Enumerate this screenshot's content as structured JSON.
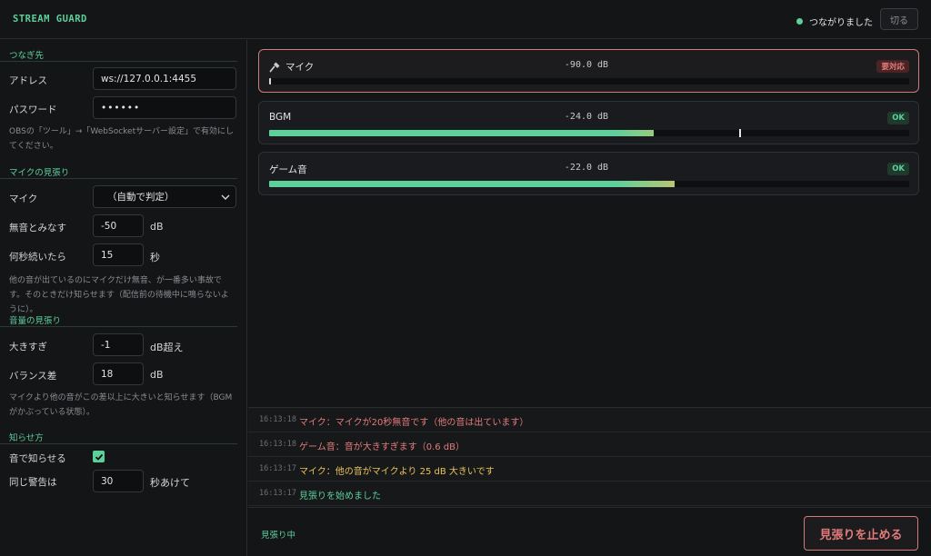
{
  "app": {
    "title": "STREAM GUARD"
  },
  "connection": {
    "status": "つながりました",
    "disconnect_label": "切る",
    "status_color": "#5ccf9b"
  },
  "sidebar": {
    "connect": {
      "title": "つなぎ先",
      "address_label": "アドレス",
      "address_value": "ws://127.0.0.1:4455",
      "password_label": "パスワード",
      "password_value": "••••••",
      "hint": "OBSの「ツール」→「WebSocketサーバー設定」で有効にしてください。"
    },
    "mic_watch": {
      "title": "マイクの見張り",
      "mic_label": "マイク",
      "mic_selected": "（自動で判定）",
      "silence_label": "無音とみなす",
      "silence_value": "-50",
      "silence_unit": "dB",
      "duration_label": "何秒続いたら",
      "duration_value": "15",
      "duration_unit": "秒",
      "hint": "他の音が出ているのにマイクだけ無音、が一番多い事故です。そのときだけ知らせます（配信前の待機中に鳴らないように）。"
    },
    "volume_watch": {
      "title": "音量の見張り",
      "loud_label": "大きすぎ",
      "loud_value": "-1",
      "loud_unit": "dB超え",
      "balance_label": "バランス差",
      "balance_value": "18",
      "balance_unit": "dB",
      "hint": "マイクより他の音がこの差以上に大きいと知らせます（BGMがかぶっている状態）。"
    },
    "notify": {
      "title": "知らせ方",
      "sound_label": "音で知らせる",
      "sound_checked": true,
      "repeat_label": "同じ警告は",
      "repeat_value": "30",
      "repeat_unit": "秒あけて"
    }
  },
  "meters": [
    {
      "name": "マイク",
      "db": "-90.0 dB",
      "badge": "要対応",
      "state": "bad",
      "level": 0.003,
      "peak": null,
      "icon": "microphone-icon"
    },
    {
      "name": "BGM",
      "db": "-24.0 dB",
      "badge": "OK",
      "state": "ok",
      "level": 0.601,
      "peak": 0.734,
      "icon": null
    },
    {
      "name": "ゲーム音",
      "db": "-22.0 dB",
      "badge": "OK",
      "state": "ok",
      "level": 0.633,
      "peak": null,
      "icon": null
    }
  ],
  "log": [
    {
      "time": "16:13:18",
      "message": "マイク：マイクが20秒無音です（他の音は出ています）",
      "color": "#e27b7b"
    },
    {
      "time": "16:13:18",
      "message": "ゲーム音：音が大きすぎます（0.6 dB）",
      "color": "#e27b7b"
    },
    {
      "time": "16:13:17",
      "message": "マイク：他の音がマイクより 25 dB 大きいです",
      "color": "#e8c25a"
    },
    {
      "time": "16:13:17",
      "message": "見張りを始めました",
      "color": "#5ccf9b"
    }
  ],
  "footer": {
    "status": "見張り中",
    "stop_label": "見張りを止める"
  }
}
